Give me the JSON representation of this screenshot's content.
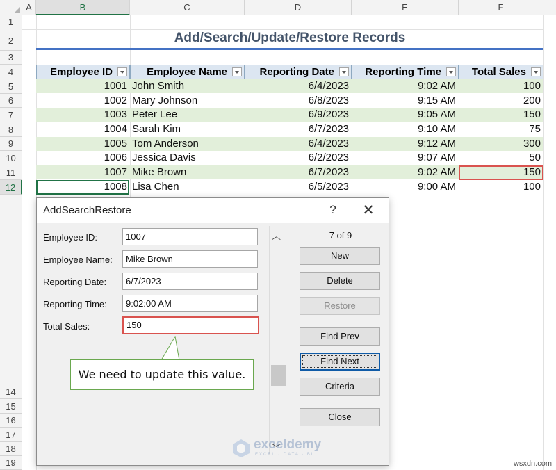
{
  "columns": [
    "A",
    "B",
    "C",
    "D",
    "E",
    "F"
  ],
  "rows_top": [
    "1",
    "2",
    "3",
    "4",
    "5",
    "6",
    "7",
    "8",
    "9",
    "10",
    "11",
    "12"
  ],
  "rows_bottom": [
    "14",
    "15",
    "16",
    "17",
    "18",
    "19"
  ],
  "sheet_title": "Add/Search/Update/Restore Records",
  "table": {
    "headers": [
      "Employee ID",
      "Employee Name",
      "Reporting Date",
      "Reporting Time",
      "Total Sales"
    ],
    "rows": [
      [
        "1001",
        "John Smith",
        "6/4/2023",
        "9:02 AM",
        "100"
      ],
      [
        "1002",
        "Mary Johnson",
        "6/8/2023",
        "9:15 AM",
        "200"
      ],
      [
        "1003",
        "Peter Lee",
        "6/9/2023",
        "9:05 AM",
        "150"
      ],
      [
        "1004",
        "Sarah Kim",
        "6/7/2023",
        "9:10 AM",
        "75"
      ],
      [
        "1005",
        "Tom Anderson",
        "6/4/2023",
        "9:12 AM",
        "300"
      ],
      [
        "1006",
        "Jessica Davis",
        "6/2/2023",
        "9:07 AM",
        "50"
      ],
      [
        "1007",
        "Mike Brown",
        "6/7/2023",
        "9:02 AM",
        "150"
      ],
      [
        "1008",
        "Lisa Chen",
        "6/5/2023",
        "9:00 AM",
        "100"
      ]
    ]
  },
  "dialog": {
    "title": "AddSearchRestore",
    "help": "?",
    "close": "✕",
    "fields": [
      {
        "label": "Employee ID:",
        "value": "1007"
      },
      {
        "label": "Employee Name:",
        "value": "Mike Brown"
      },
      {
        "label": "Reporting Date:",
        "value": "6/7/2023"
      },
      {
        "label": "Reporting Time:",
        "value": "9:02:00 AM"
      },
      {
        "label": "Total Sales:",
        "value": "150"
      }
    ],
    "record_counter": "7 of 9",
    "buttons": {
      "new": "New",
      "delete": "Delete",
      "restore": "Restore",
      "find_prev": "Find Prev",
      "find_next": "Find Next",
      "criteria": "Criteria",
      "close": "Close"
    },
    "callout": "We need to update this value."
  },
  "watermark": {
    "name": "exceldemy",
    "sub": "EXCEL · DATA · BI"
  },
  "site": "wsxdn.com",
  "colors": {
    "accent_green": "#217346",
    "table_header": "#dce6f1",
    "band": "#e2efda",
    "highlight_red": "#d9534f",
    "title_rule": "#4472c4"
  }
}
